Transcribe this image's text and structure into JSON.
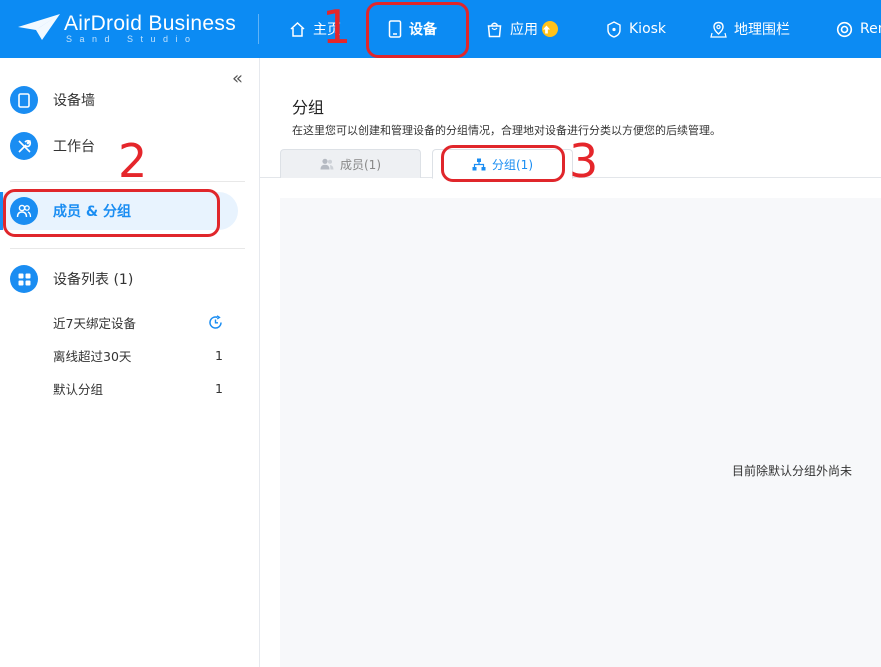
{
  "header": {
    "brand": "AirDroid Business",
    "brand_sub": "Sand Studio",
    "nav": [
      {
        "label": "主页",
        "icon": "home-icon"
      },
      {
        "label": "设备",
        "icon": "tablet-icon",
        "active": true
      },
      {
        "label": "应用",
        "icon": "shopping-bag-icon",
        "badge": "upgrade-arrow-icon"
      },
      {
        "label": "Kiosk",
        "icon": "kiosk-lock-icon"
      },
      {
        "label": "地理围栏",
        "icon": "map-pin-icon"
      },
      {
        "label": "Rem",
        "icon": "lifebuoy-icon"
      }
    ]
  },
  "sidebar": {
    "items": [
      {
        "label": "设备墙",
        "icon": "tablet-icon"
      },
      {
        "label": "工作台",
        "icon": "tools-icon"
      },
      {
        "label": "成员 & 分组",
        "icon": "users-icon",
        "active": true
      },
      {
        "label": "设备列表 (1)",
        "icon": "grid-icon"
      }
    ],
    "sub_items": [
      {
        "label": "近7天绑定设备",
        "count": ""
      },
      {
        "label": "离线超过30天",
        "count": "1"
      },
      {
        "label": "默认分组",
        "count": "1"
      }
    ]
  },
  "main": {
    "title": "分组",
    "description": "在这里您可以创建和管理设备的分组情况，合理地对设备进行分类以方便您的后续管理。",
    "tabs": [
      {
        "label": "成员(1)",
        "icon": "user-icon"
      },
      {
        "label": "分组(1)",
        "icon": "hierarchy-icon",
        "active": true
      }
    ],
    "empty_text": "目前除默认分组外尚未"
  },
  "annotations": [
    "1",
    "2",
    "3"
  ],
  "colors": {
    "header_bg": "#0c8bf3",
    "accent": "#1a8df2",
    "annotation_red": "#e0262b",
    "upgrade_badge": "#ffc21a"
  }
}
